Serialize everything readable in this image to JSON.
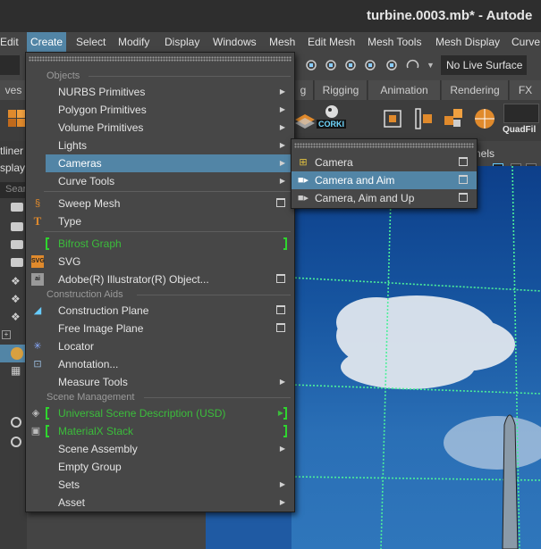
{
  "window": {
    "title": "turbine.0003.mb* - Autode"
  },
  "menubar": {
    "items": [
      "Edit",
      "Create",
      "Select",
      "Modify",
      "Display",
      "Windows",
      "Mesh",
      "Edit Mesh",
      "Mesh Tools",
      "Mesh Display",
      "Curve"
    ],
    "active": "Create"
  },
  "toolbar": {
    "live_surface": "No Live Surface"
  },
  "shelf_tabs": [
    "ves",
    "g",
    "Rigging",
    "Animation",
    "Rendering",
    "FX"
  ],
  "shelf": {
    "corki_label": "CORKI",
    "quadfill_label": "QuadFil"
  },
  "outliner": {
    "title": "tliner",
    "display": "splay",
    "search": "Sear"
  },
  "viewport": {
    "panel_label": "nels"
  },
  "create_menu": {
    "items": [
      {
        "type": "section",
        "label": "Objects"
      },
      {
        "type": "item",
        "label": "NURBS Primitives",
        "submenu": true
      },
      {
        "type": "item",
        "label": "Polygon Primitives",
        "submenu": true
      },
      {
        "type": "item",
        "label": "Volume Primitives",
        "submenu": true
      },
      {
        "type": "item",
        "label": "Lights",
        "submenu": true
      },
      {
        "type": "item",
        "label": "Cameras",
        "submenu": true,
        "highlight": true
      },
      {
        "type": "item",
        "label": "Curve Tools",
        "submenu": true
      },
      {
        "type": "sep"
      },
      {
        "type": "item",
        "label": "Sweep Mesh",
        "option": true,
        "icon": "sweep-mesh-icon"
      },
      {
        "type": "item",
        "label": "Type",
        "icon": "type-icon"
      },
      {
        "type": "sep"
      },
      {
        "type": "item",
        "label": "Bifrost Graph",
        "green": true
      },
      {
        "type": "item",
        "label": "SVG",
        "icon": "svg-icon"
      },
      {
        "type": "item",
        "label": "Adobe(R) Illustrator(R) Object...",
        "option": true,
        "icon": "illustrator-icon"
      },
      {
        "type": "section",
        "label": "Construction Aids"
      },
      {
        "type": "item",
        "label": "Construction Plane",
        "option": true,
        "icon": "construction-plane-icon"
      },
      {
        "type": "item",
        "label": "Free Image Plane",
        "option": true
      },
      {
        "type": "item",
        "label": "Locator",
        "icon": "locator-icon"
      },
      {
        "type": "item",
        "label": "Annotation...",
        "icon": "annotation-icon"
      },
      {
        "type": "item",
        "label": "Measure Tools",
        "submenu": true
      },
      {
        "type": "section",
        "label": "Scene Management"
      },
      {
        "type": "item",
        "label": "Universal Scene Description (USD)",
        "green": true,
        "submenu": true,
        "icon": "usd-icon"
      },
      {
        "type": "item",
        "label": "MaterialX Stack",
        "green": true,
        "icon": "materialx-icon"
      },
      {
        "type": "item",
        "label": "Scene Assembly",
        "submenu": true
      },
      {
        "type": "item",
        "label": "Empty Group"
      },
      {
        "type": "item",
        "label": "Sets",
        "submenu": true
      },
      {
        "type": "item",
        "label": "Asset",
        "submenu": true
      }
    ]
  },
  "cameras_submenu": {
    "items": [
      {
        "label": "Camera",
        "icon": "camera-icon"
      },
      {
        "label": "Camera and Aim",
        "icon": "camera-aim-icon",
        "highlight": true
      },
      {
        "label": "Camera, Aim and Up",
        "icon": "camera-aim-up-icon"
      }
    ]
  },
  "colors": {
    "accent": "#5285a6",
    "green": "#3bbd3b",
    "menu_bg": "#474747",
    "grid": "#4cf09a"
  }
}
